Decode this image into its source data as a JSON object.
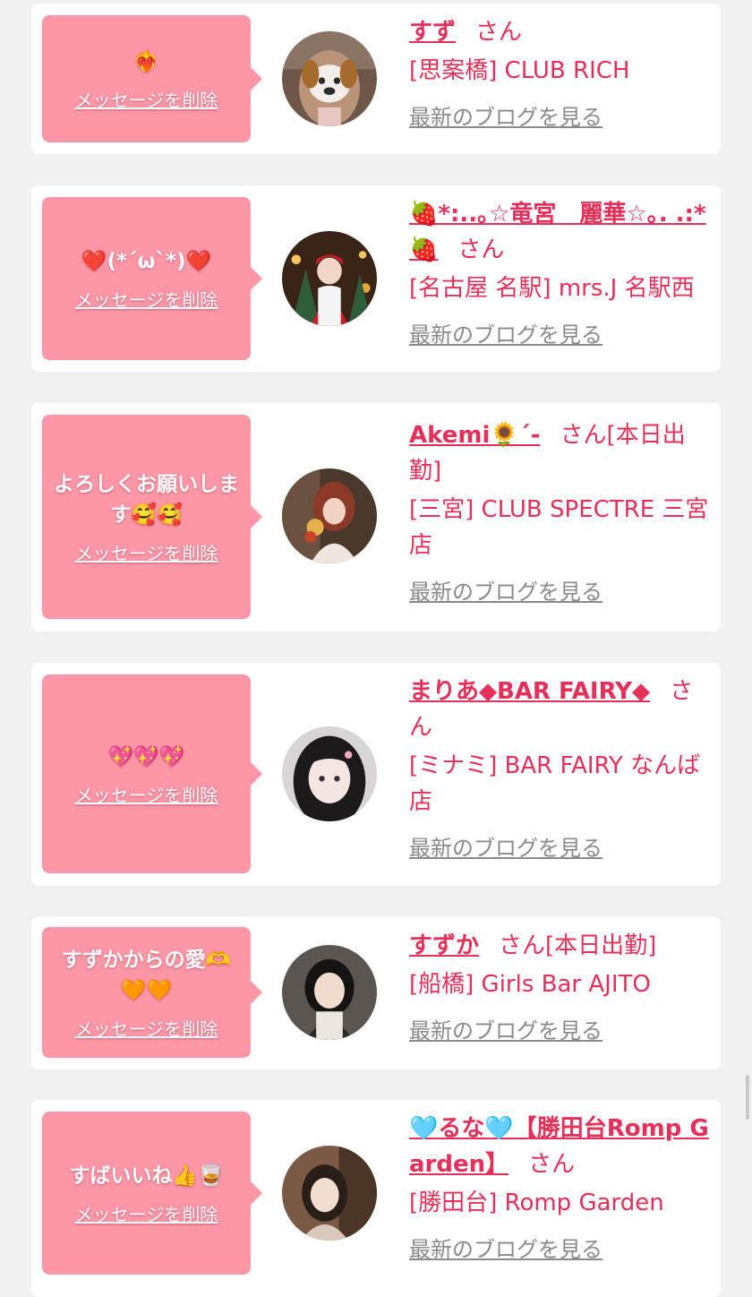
{
  "delete_label": "メッセージを削除",
  "blog_label": "最新のブログを見る",
  "san_label": "さん",
  "colors": {
    "accent": "#e4305a",
    "bubble": "#fd96a6",
    "page": "#f1f1f1"
  },
  "cards": [
    {
      "message": "❤️‍🔥",
      "name": "すず",
      "san_suffix": "",
      "shop": "[思案橋] CLUB RICH"
    },
    {
      "message": "❤️(*´ω`*)❤️",
      "name": "🍓*:..｡☆竜宮　麗華☆｡. .:*🍓",
      "san_suffix": "",
      "shop": "[名古屋 名駅] mrs.J 名駅西"
    },
    {
      "message": "よろしくお願いします🥰🥰",
      "name": "Akemi🌻´-",
      "san_suffix": "[本日出勤]",
      "shop": "[三宮] CLUB SPECTRE 三宮店"
    },
    {
      "message": "💖💖💖",
      "name": "まりあ◆BAR FAIRY◆",
      "san_suffix": "",
      "shop": "[ミナミ] BAR FAIRY なんば店"
    },
    {
      "message": "すずかからの愛🫶🧡🧡",
      "name": "すずか",
      "san_suffix": "[本日出勤]",
      "shop": "[船橋] Girls Bar AJITO"
    },
    {
      "message": "すばいいね👍🥃",
      "name": "🩵るな🩵【勝田台Romp Garden】",
      "san_suffix": "",
      "shop": "[勝田台] Romp Garden"
    }
  ]
}
